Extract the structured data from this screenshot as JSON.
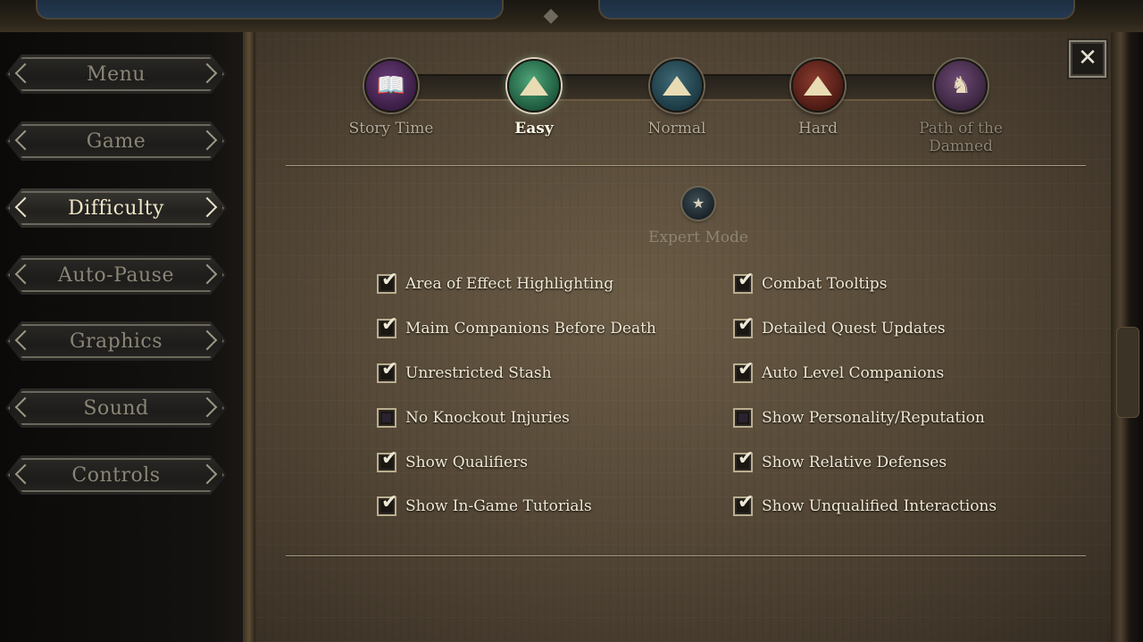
{
  "nav": {
    "items": [
      {
        "label": "Menu",
        "active": false
      },
      {
        "label": "Game",
        "active": false
      },
      {
        "label": "Difficulty",
        "active": true
      },
      {
        "label": "Auto-Pause",
        "active": false
      },
      {
        "label": "Graphics",
        "active": false
      },
      {
        "label": "Sound",
        "active": false
      },
      {
        "label": "Controls",
        "active": false
      }
    ]
  },
  "close_button": {
    "icon": "close-icon",
    "glyph": "✕"
  },
  "difficulty": {
    "selected": "Easy",
    "levels": [
      {
        "label": "Story Time",
        "icon": "book-icon",
        "glyph": "📖"
      },
      {
        "label": "Easy",
        "icon": "mountain-icon"
      },
      {
        "label": "Normal",
        "icon": "mountain-icon"
      },
      {
        "label": "Hard",
        "icon": "mountain-icon"
      },
      {
        "label": "Path of the Damned",
        "icon": "damned-figures-icon",
        "glyph": "♞"
      }
    ]
  },
  "expert_mode": {
    "label": "Expert Mode",
    "icon": "expert-head-icon",
    "glyph": "★",
    "enabled": false
  },
  "options": {
    "left": [
      {
        "label": "Area of Effect Highlighting",
        "checked": true
      },
      {
        "label": "Maim Companions Before Death",
        "checked": true
      },
      {
        "label": "Unrestricted Stash",
        "checked": true
      },
      {
        "label": "No Knockout Injuries",
        "checked": false
      },
      {
        "label": "Show Qualifiers",
        "checked": true
      },
      {
        "label": "Show In-Game Tutorials",
        "checked": true
      }
    ],
    "right": [
      {
        "label": "Combat Tooltips",
        "checked": true
      },
      {
        "label": "Detailed Quest Updates",
        "checked": true
      },
      {
        "label": "Auto Level Companions",
        "checked": true
      },
      {
        "label": "Show Personality/Reputation",
        "checked": false
      },
      {
        "label": "Show Relative Defenses",
        "checked": true
      },
      {
        "label": "Show Unqualified Interactions",
        "checked": true
      }
    ]
  },
  "check_glyph": "✔"
}
